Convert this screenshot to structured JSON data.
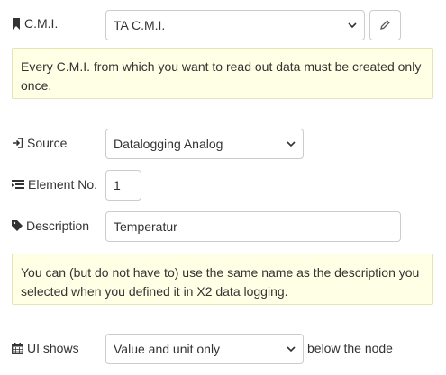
{
  "cmi": {
    "label": "C.M.I.",
    "icon": "bookmark-icon",
    "selected": "TA C.M.I.",
    "edit_icon": "pencil-icon",
    "note": "Every C.M.I. from which you want to read out data must be created only once."
  },
  "source": {
    "label": "Source",
    "icon": "sign-in-icon",
    "selected": "Datalogging Analog"
  },
  "element_no": {
    "label": "Element No.",
    "icon": "list-icon",
    "value": "1"
  },
  "description": {
    "label": "Description",
    "icon": "tag-icon",
    "value": "Temperatur",
    "note": "You can (but do not have to) use the same name as the description you selected when you defined it in X2 data logging."
  },
  "ui_shows": {
    "label": "UI shows",
    "icon": "calendar-icon",
    "selected": "Value and unit only",
    "suffix": "below the node"
  }
}
